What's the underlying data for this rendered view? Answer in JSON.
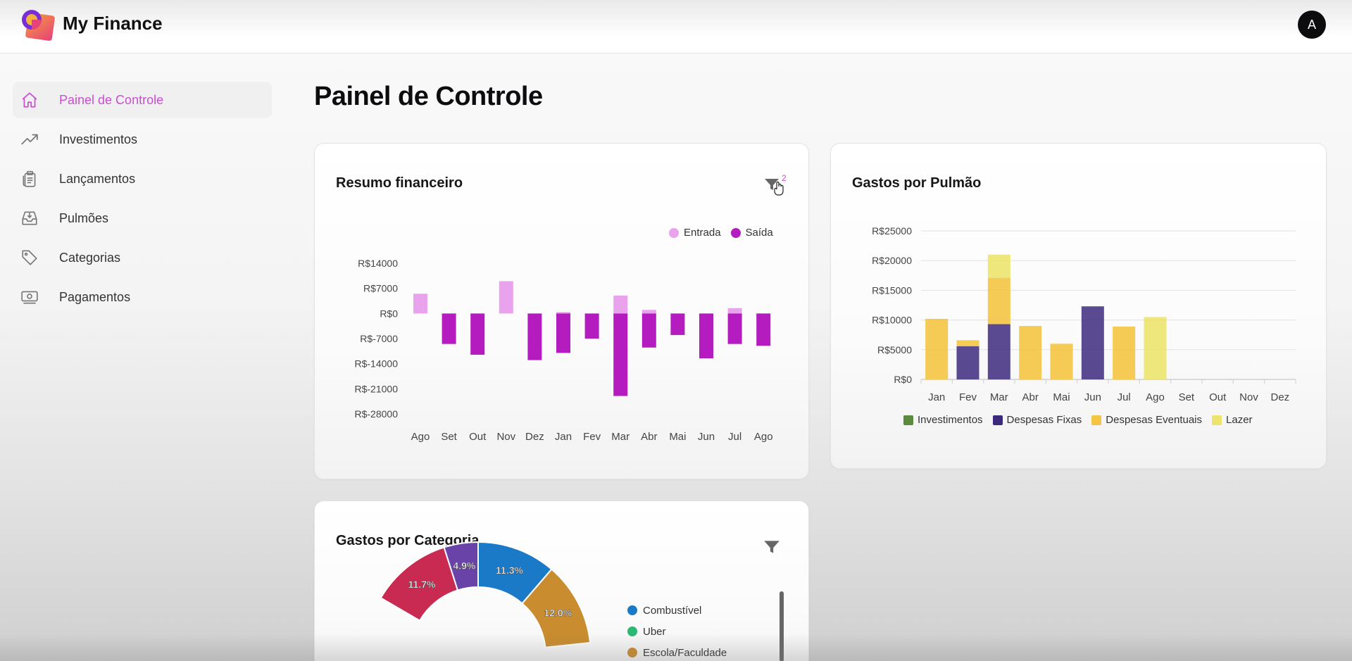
{
  "app": {
    "title": "My Finance",
    "avatar_letter": "A"
  },
  "sidebar": {
    "items": [
      {
        "label": "Painel de Controle",
        "icon": "home-icon",
        "active": true
      },
      {
        "label": "Investimentos",
        "icon": "trending-up-icon",
        "active": false
      },
      {
        "label": "Lançamentos",
        "icon": "clipboard-icon",
        "active": false
      },
      {
        "label": "Pulmões",
        "icon": "inbox-icon",
        "active": false
      },
      {
        "label": "Categorias",
        "icon": "tag-icon",
        "active": false
      },
      {
        "label": "Pagamentos",
        "icon": "cash-icon",
        "active": false
      }
    ]
  },
  "page": {
    "title": "Painel de Controle"
  },
  "colors": {
    "accent": "#c94fd1",
    "entrada": "#e9a3ec",
    "saida": "#b41cc0",
    "investimentos": "#5c8a3e",
    "despesas_fixas": "#3d2a7f",
    "despesas_eventuais": "#f4c442",
    "lazer": "#ece46d"
  },
  "resumo": {
    "title": "Resumo financeiro",
    "filter_badge": "2",
    "legend": [
      "Entrada",
      "Saída"
    ]
  },
  "pulmao": {
    "title": "Gastos por Pulmão",
    "legend": [
      "Investimentos",
      "Despesas Fixas",
      "Despesas Eventuais",
      "Lazer"
    ]
  },
  "categoria": {
    "title": "Gastos por Categoria",
    "legend": [
      {
        "label": "Combustível",
        "color": "#1a7ac8"
      },
      {
        "label": "Uber",
        "color": "#2bb873"
      },
      {
        "label": "Escola/Faculdade",
        "color": "#c98c2e"
      }
    ]
  },
  "chart_data": [
    {
      "type": "bar",
      "title": "Resumo financeiro",
      "categories": [
        "Ago",
        "Set",
        "Out",
        "Nov",
        "Dez",
        "Jan",
        "Fev",
        "Mar",
        "Abr",
        "Mai",
        "Jun",
        "Jul",
        "Ago"
      ],
      "yticks": [
        "R$14000",
        "R$7000",
        "R$0",
        "R$-7000",
        "R$-14000",
        "R$-21000",
        "R$-28000"
      ],
      "ylim": [
        -28000,
        14000
      ],
      "series": [
        {
          "name": "Entrada",
          "values": [
            5500,
            0,
            0,
            9000,
            0,
            400,
            0,
            5000,
            1000,
            0,
            0,
            1500,
            0
          ]
        },
        {
          "name": "Saída",
          "values": [
            0,
            -8500,
            -11500,
            0,
            -13000,
            -11000,
            -7000,
            -23000,
            -9500,
            -6000,
            -12500,
            -8500,
            -9000
          ]
        }
      ]
    },
    {
      "type": "bar",
      "stacked": true,
      "title": "Gastos por Pulmão",
      "categories": [
        "Jan",
        "Fev",
        "Mar",
        "Abr",
        "Mai",
        "Jun",
        "Jul",
        "Ago",
        "Set",
        "Out",
        "Nov",
        "Dez"
      ],
      "yticks": [
        "R$25000",
        "R$20000",
        "R$15000",
        "R$10000",
        "R$5000",
        "R$0"
      ],
      "ylim": [
        0,
        25000
      ],
      "series": [
        {
          "name": "Investimentos",
          "values": [
            0,
            0,
            0,
            0,
            0,
            0,
            0,
            0,
            0,
            0,
            0,
            0
          ]
        },
        {
          "name": "Despesas Fixas",
          "values": [
            0,
            5600,
            9300,
            0,
            0,
            12300,
            0,
            0,
            0,
            0,
            0,
            0
          ]
        },
        {
          "name": "Despesas Eventuais",
          "values": [
            10200,
            1000,
            7800,
            9000,
            6000,
            0,
            8900,
            0,
            0,
            0,
            0,
            0
          ]
        },
        {
          "name": "Lazer",
          "values": [
            0,
            0,
            3900,
            0,
            0,
            0,
            0,
            10500,
            0,
            0,
            0,
            0
          ]
        }
      ]
    },
    {
      "type": "pie",
      "title": "Gastos por Categoria",
      "slices": [
        {
          "label": "Combustível",
          "value": 11.3,
          "color": "#1a7ac8",
          "text": "11.3%"
        },
        {
          "label": "Escola/Faculdade",
          "value": 12.0,
          "color": "#c98c2e",
          "text": "12.0%"
        },
        {
          "label": "",
          "value": 11.7,
          "color": "#c92a52",
          "text": "11.7%"
        },
        {
          "label": "",
          "value": 4.9,
          "color": "#6a43a8",
          "text": "4.9%"
        }
      ]
    }
  ]
}
